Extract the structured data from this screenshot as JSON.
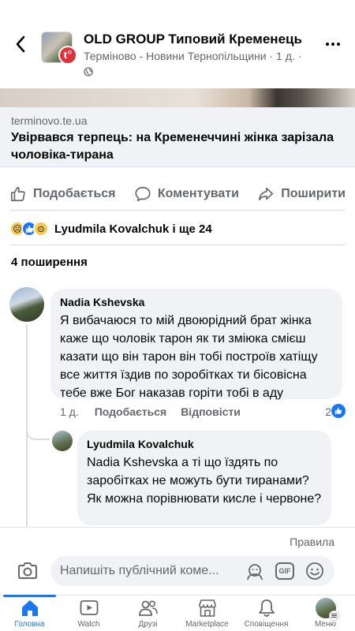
{
  "header": {
    "title": "OLD GROUP Типовий Кременець",
    "badge_letter": "t°",
    "subtitle_source": "Терміново - Новини Тернопільщини",
    "subtitle_time": " · 1 д. · "
  },
  "link": {
    "domain": "terminovo.te.ua",
    "title": "Увірвався терпець: на Кременеччині жінка зарізала чоловіка-тирана"
  },
  "actions": {
    "like": "Подобається",
    "comment": "Коментувати",
    "share": "Поширити"
  },
  "reactions": {
    "text": "Lyudmila  Kovalchuk і ще 24"
  },
  "shares": "4 поширення",
  "comments": [
    {
      "author": "Nadia Kshevska",
      "text": "Я вибачаюся то мій двоюрідний брат жінка каже що чоловік тарон як ти зміюка смієш казати що він тарон він тобі построїв хатіщу все життя їздив по зоробітках ти бісовісна тебе вже Бог наказав горіти тобі в аду",
      "time": "1 д.",
      "like_label": "Подобається",
      "reply_label": "Відповісти",
      "reaction_count": "2"
    },
    {
      "author": "Lyudmila  Kovalchuk",
      "text": "Nadia Kshevska а ті що їздять по заробітках не можуть бути тиранами? Як можна порівнювати кисле і червоне?"
    }
  ],
  "compose": {
    "rules": "Правила",
    "placeholder": "Напишіть публічний коме..."
  },
  "tabs": [
    {
      "label": "Головна",
      "icon": "home-icon"
    },
    {
      "label": "Watch",
      "icon": "watch-icon"
    },
    {
      "label": "Друзі",
      "icon": "friends-icon"
    },
    {
      "label": "Marketplace",
      "icon": "marketplace-icon"
    },
    {
      "label": "Сповіщення",
      "icon": "bell-icon"
    },
    {
      "label": "Меню",
      "icon": "menu-avatar"
    }
  ],
  "colors": {
    "accent": "#1877f2",
    "secondary_text": "#65676b",
    "bubble": "#f0f2f5"
  }
}
